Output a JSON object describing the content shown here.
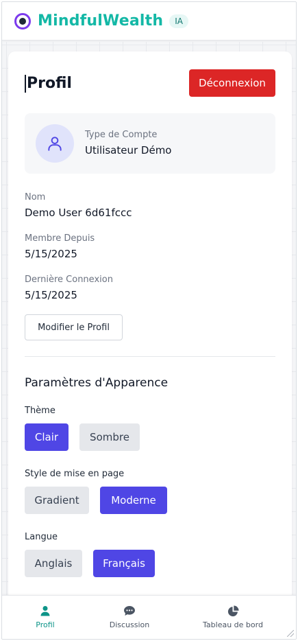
{
  "header": {
    "brand": "MindfulWealth",
    "badge": "IA"
  },
  "profile": {
    "title": "Profil",
    "logout_label": "Déconnexion",
    "account_type_label": "Type de Compte",
    "account_type_value": "Utilisateur Démo",
    "name_label": "Nom",
    "name_value": "Demo User 6d61fccc",
    "member_since_label": "Membre Depuis",
    "member_since_value": "5/15/2025",
    "last_login_label": "Dernière Connexion",
    "last_login_value": "5/15/2025",
    "edit_label": "Modifier le Profil"
  },
  "appearance": {
    "section_title": "Paramètres d'Apparence",
    "theme_label": "Thème",
    "theme_options": [
      "Clair",
      "Sombre"
    ],
    "theme_selected": "Clair",
    "layout_label": "Style de mise en page",
    "layout_options": [
      "Gradient",
      "Moderne"
    ],
    "layout_selected": "Moderne",
    "language_label": "Langue",
    "language_options": [
      "Anglais",
      "Français"
    ],
    "language_selected": "Français"
  },
  "bottom_nav": {
    "items": [
      {
        "label": "Profil",
        "icon": "user-icon",
        "active": true
      },
      {
        "label": "Discussion",
        "icon": "chat-icon",
        "active": false
      },
      {
        "label": "Tableau de bord",
        "icon": "pie-chart-icon",
        "active": false
      }
    ]
  },
  "colors": {
    "brand": "#14b8a6",
    "accent": "#4f46e5",
    "danger": "#dc2626",
    "logo_ring": "#7c3aed"
  }
}
